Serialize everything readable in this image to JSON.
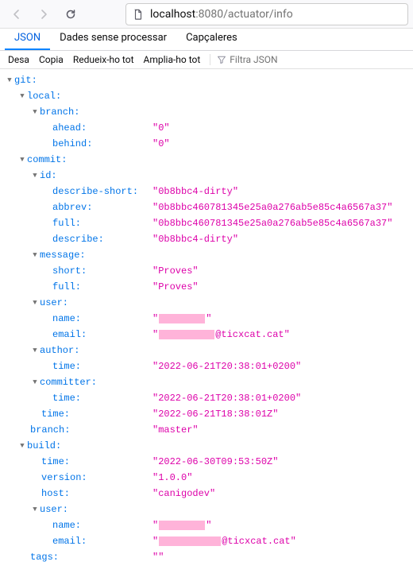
{
  "url": {
    "host": "localhost",
    "port": ":8080",
    "path": "/actuator/info"
  },
  "tabs": {
    "json": "JSON",
    "raw": "Dades sense processar",
    "headers": "Capçaleres"
  },
  "subbar": {
    "save": "Desa",
    "copy": "Copia",
    "collapse": "Redueix-ho tot",
    "expand": "Amplia-ho tot",
    "filter": "Filtra JSON"
  },
  "k": {
    "git": "git:",
    "local": "local:",
    "branch": "branch:",
    "ahead": "ahead:",
    "behind": "behind:",
    "commit": "commit:",
    "id": "id:",
    "describe_short": "describe-short:",
    "abbrev": "abbrev:",
    "full": "full:",
    "describe": "describe:",
    "message": "message:",
    "short": "short:",
    "user": "user:",
    "name": "name:",
    "email": "email:",
    "author": "author:",
    "time": "time:",
    "committer": "committer:",
    "build": "build:",
    "version": "version:",
    "host": "host:",
    "tags": "tags:"
  },
  "v": {
    "ahead": "\"0\"",
    "behind": "\"0\"",
    "describe_short": "\"0b8bbc4-dirty\"",
    "abbrev": "\"0b8bbc460781345e25a0a276ab5e85c4a6567a37\"",
    "full_id": "\"0b8bbc460781345e25a0a276ab5e85c4a6567a37\"",
    "describe": "\"0b8bbc4-dirty\"",
    "msg_short": "\"Proves\"",
    "msg_full": "\"Proves\"",
    "user_email_domain": "@ticxcat.cat\"",
    "author_time": "\"2022-06-21T20:38:01+0200\"",
    "committer_time": "\"2022-06-21T20:38:01+0200\"",
    "commit_time": "\"2022-06-21T18:38:01Z\"",
    "commit_branch": "\"master\"",
    "build_time": "\"2022-06-30T09:53:50Z\"",
    "build_version": "\"1.0.0\"",
    "build_host": "\"canigodev\"",
    "tags": "\"\"",
    "q": "\""
  }
}
